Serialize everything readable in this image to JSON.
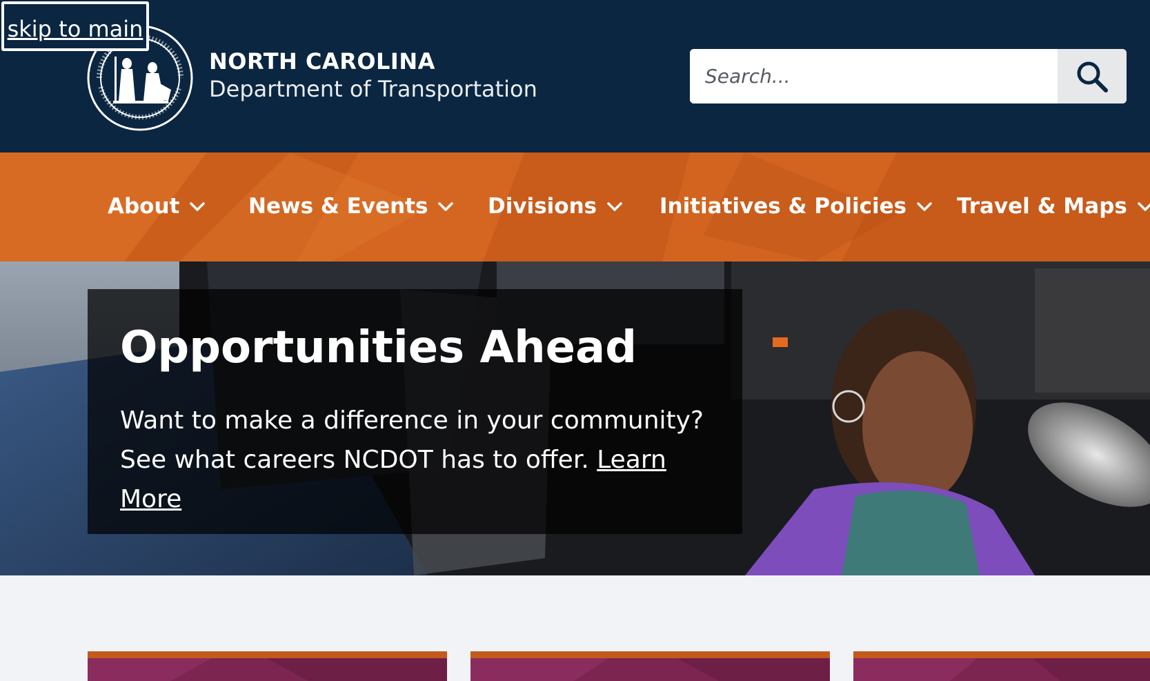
{
  "skip_link": {
    "label": "skip to main"
  },
  "brand": {
    "line1": "NORTH CAROLINA",
    "line2": "Department of Transportation",
    "seal_texts": [
      "THE GREAT SEAL",
      "OF",
      "NORTH CAROLINA",
      "APRIL 12, 1776",
      "ESSE QUAM VIDERI"
    ]
  },
  "search": {
    "placeholder": "Search...",
    "value": "",
    "button_icon": "search-icon"
  },
  "nav": {
    "items": [
      {
        "label": "About",
        "icon": "chevron-down-icon"
      },
      {
        "label": "News & Events",
        "icon": "chevron-down-icon"
      },
      {
        "label": "Divisions",
        "icon": "chevron-down-icon"
      },
      {
        "label": "Initiatives & Policies",
        "icon": "chevron-down-icon"
      },
      {
        "label": "Travel & Maps",
        "icon": "chevron-down-icon"
      }
    ]
  },
  "hero": {
    "title": "Opportunities Ahead",
    "text": "Want to make a difference in your community? See what careers NCDOT has to offer.",
    "link_label": "Learn More"
  },
  "colors": {
    "header_bg": "#0b2641",
    "nav_bg": "#d2641f",
    "card_accent": "#c35a1c",
    "card_bg": "#7b2550",
    "page_bg": "#f2f3f6"
  }
}
